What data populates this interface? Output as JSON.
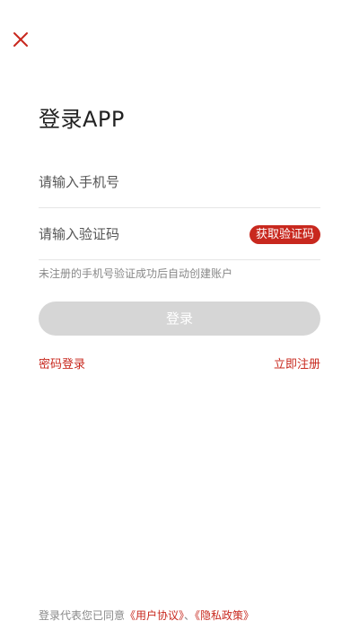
{
  "header": {
    "close_icon": "close-icon",
    "accent_color": "#c8281e"
  },
  "title": "登录APP",
  "phone_field": {
    "placeholder": "请输入手机号",
    "value": ""
  },
  "code_field": {
    "placeholder": "请输入验证码",
    "value": "",
    "get_code_label": "获取验证码"
  },
  "hint": "未注册的手机号验证成功后自动创建账户",
  "login_button": {
    "label": "登录",
    "disabled_color": "#d6d6d6"
  },
  "links": {
    "password_login": "密码登录",
    "register": "立即注册"
  },
  "agreement": {
    "prefix": "登录代表您已同意",
    "user_agreement": "《用户协议》",
    "separator": "、",
    "privacy_policy": "《隐私政策》"
  }
}
